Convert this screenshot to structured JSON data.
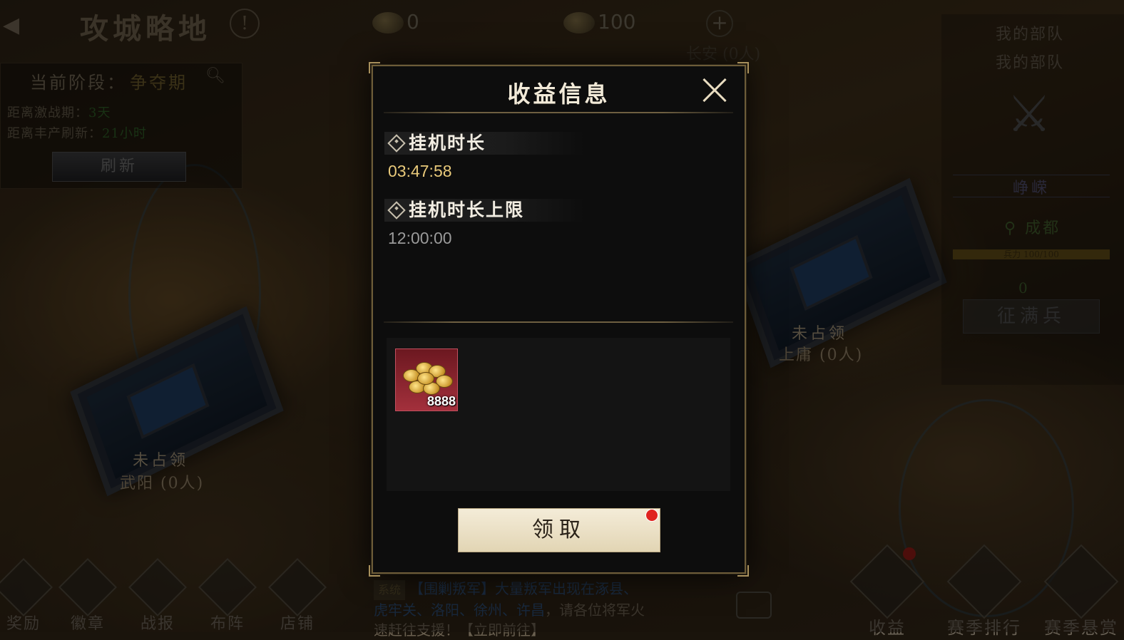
{
  "top_bar": {
    "title": "攻城略地",
    "copper": "0",
    "food": "100",
    "city_hint": "长安 (0人)"
  },
  "phase_panel": {
    "label": "当前阶段：",
    "value": "争夺期",
    "line1_label": "距离激战期：",
    "line1_value": "3天",
    "line2_label": "距离丰产刷新：",
    "line2_value": "21小时",
    "refresh_label": "刷新"
  },
  "map_cities": [
    {
      "status": "未占领",
      "name": "武阳 (0人)"
    },
    {
      "status": "未占领",
      "name": "上庸 (0人)"
    }
  ],
  "right_panel": {
    "title1": "我的部队",
    "title2": "我的部队",
    "army_name": "峥嵘",
    "location": "成都",
    "troop_label": "兵力",
    "troop_value": "100/100",
    "troop_fill": 1.0,
    "count": "0",
    "conscript_label": "征满兵"
  },
  "bottom_nav": {
    "items": [
      "奖励",
      "徽章",
      "战报",
      "布阵",
      "店铺"
    ],
    "big_items": [
      "收益",
      "赛季排行",
      "赛季悬赏"
    ]
  },
  "system_message": {
    "tag": "系统",
    "line1a": "【围剿叛军】大量叛军出现在",
    "line1b": "涿县、",
    "line2a": "虎牢关、洛阳、徐州、许昌",
    "line2b": "，请各位将军火",
    "line3": "速赶往支援！【立即前往】"
  },
  "modal": {
    "title": "收益信息",
    "section1_title": "挂机时长",
    "section1_value": "03:47:58",
    "section1_color": "#e8c97a",
    "section2_title": "挂机时长上限",
    "section2_value": "12:00:00",
    "section2_color": "#9a9a9a",
    "reward_count": "8888",
    "claim_label": "领取"
  }
}
